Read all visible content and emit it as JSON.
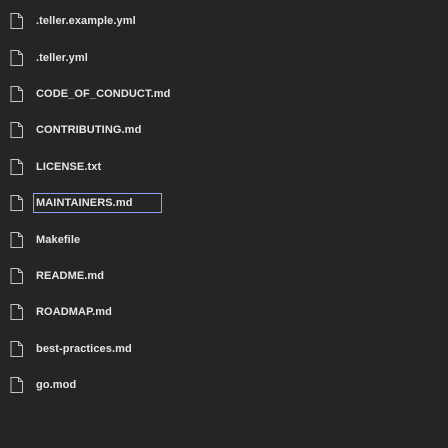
{
  "explorer": {
    "files": [
      {
        "name": ".teller.example.yml",
        "icon": "file-icon"
      },
      {
        "name": ".teller.yml",
        "icon": "file-icon"
      },
      {
        "name": "CODE_OF_CONDUCT.md",
        "icon": "file-icon"
      },
      {
        "name": "CONTRIBUTING.md",
        "icon": "file-icon"
      },
      {
        "name": "LICENSE.txt",
        "icon": "file-icon"
      },
      {
        "name": "MAINTAINERS.md",
        "icon": "file-icon"
      },
      {
        "name": "Makefile",
        "icon": "file-icon"
      },
      {
        "name": "README.md",
        "icon": "file-icon"
      },
      {
        "name": "ROADMAP.md",
        "icon": "file-icon"
      },
      {
        "name": "best-practices.md",
        "icon": "file-icon"
      },
      {
        "name": "go.mod",
        "icon": "file-icon"
      }
    ],
    "selected_index": 5,
    "colors": {
      "background": "#252526",
      "text": "#e6e6e6",
      "icon": "#c5c5c5",
      "selection_outline": "#8fa0ff"
    }
  }
}
